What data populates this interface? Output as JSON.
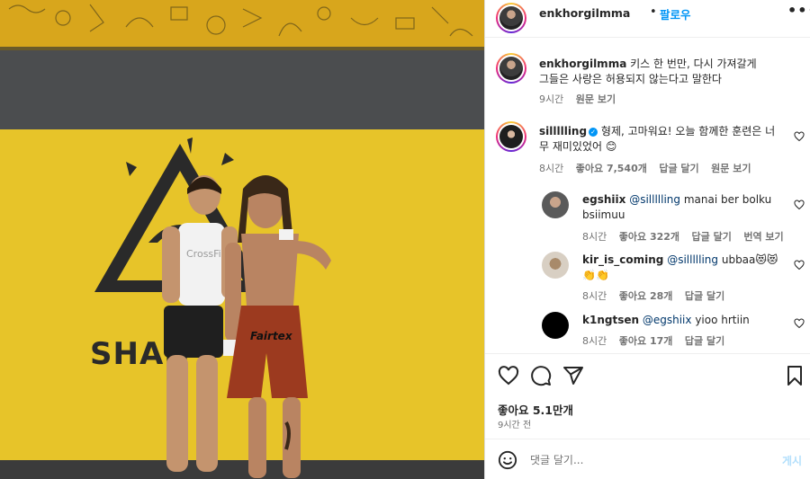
{
  "post": {
    "author": "enkhorgilmma",
    "separator": "•",
    "follow_label": "팔로우",
    "more_label": "•••",
    "photo_brand_text": "SHAN",
    "photo_shorts_brand": "Fairtex",
    "photo_shirt_brand": "CrossFi"
  },
  "caption": {
    "author": "enkhorgilmma",
    "text_line1": "키스 한 번만, 다시 가져갈게",
    "text_line2": "그들은 사랑은 허용되지 않는다고 말한다",
    "time": "9시간",
    "see_translation": "원문 보기"
  },
  "comments": [
    {
      "author": "sillllling",
      "verified": true,
      "text_line1": "형제, 고마워요! 오늘 함께한 훈련은 너",
      "text_line2": "무 재미있었어 😊",
      "time": "8시간",
      "likes": "좋아요 7,540개",
      "reply": "답글 달기",
      "translate": "원문 보기"
    }
  ],
  "replies": [
    {
      "author": "egshiix",
      "mention": "@sillllling",
      "text_line1": "manai ber bolku",
      "text_line2": "bsiimuu",
      "time": "8시간",
      "likes": "좋아요 322개",
      "reply": "답글 달기",
      "translate": "번역 보기"
    },
    {
      "author": "kir_is_coming",
      "mention": "@sillllling",
      "text_line1": "ubbaa😻😻",
      "text_line2": "👏👏",
      "time": "8시간",
      "likes": "좋아요 28개",
      "reply": "답글 달기"
    },
    {
      "author": "k1ngtsen",
      "mention": "@egshiix",
      "text_line1": "yioo hrtiin",
      "time": "8시간",
      "likes": "좋아요 17개",
      "reply": "답글 달기"
    }
  ],
  "footer": {
    "likes": "좋아요 5.1만개",
    "time": "9시간 전",
    "add_comment_placeholder": "댓글 달기...",
    "post_label": "게시"
  },
  "icons": {
    "like": "heart-icon",
    "comment": "comment-icon",
    "share": "share-icon",
    "save": "bookmark-icon",
    "emoji": "emoji-icon",
    "more": "more-icon",
    "verified": "verified-badge-icon",
    "comment_like": "small-heart-icon"
  },
  "colors": {
    "link_blue": "#0095f6",
    "mention_blue": "#00376b",
    "muted": "#737373",
    "text": "#262626"
  }
}
